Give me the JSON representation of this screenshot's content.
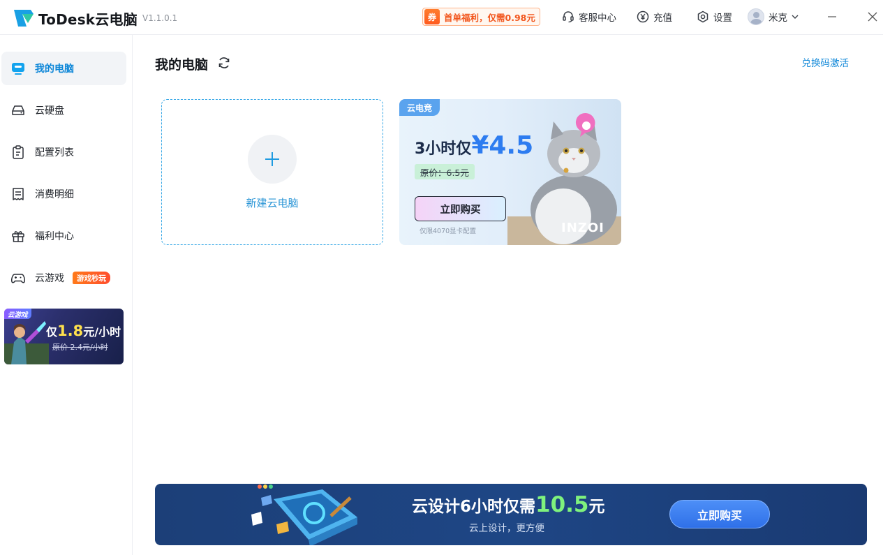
{
  "app": {
    "name": "ToDesk云电脑",
    "version": "V1.1.0.1"
  },
  "titlebar": {
    "promo_tag": "券",
    "promo_text": "首单福利，仅需0.98元",
    "service_label": "客服中心",
    "recharge_label": "充值",
    "settings_label": "设置",
    "user_name": "米克"
  },
  "sidebar": {
    "items": [
      {
        "label": "我的电脑",
        "icon": "monitor-icon",
        "active": true
      },
      {
        "label": "云硬盘",
        "icon": "hard-drive-icon"
      },
      {
        "label": "配置列表",
        "icon": "clipboard-icon"
      },
      {
        "label": "消费明细",
        "icon": "receipt-icon"
      },
      {
        "label": "福利中心",
        "icon": "gift-icon"
      },
      {
        "label": "云游戏",
        "icon": "gamepad-icon",
        "badge": "游戏秒玩"
      }
    ],
    "banner": {
      "tag": "云游戏",
      "prefix": "仅",
      "price": "1.8",
      "unit": "元/小时",
      "original": "原价 2.4元/小时"
    }
  },
  "main": {
    "title": "我的电脑",
    "redeem_link": "兑换码激活",
    "new_computer_label": "新建云电脑",
    "promo_card": {
      "tag": "云电竞",
      "headline_prefix": "3小时仅",
      "currency": "¥",
      "price": "4.5",
      "original_price": "原价：6.5元",
      "button": "立即购买",
      "note": "仅限4070显卡配置",
      "brand": "INZOI"
    }
  },
  "bottom_banner": {
    "headline": "云设计6小时仅需",
    "price": "10.5",
    "unit": "元",
    "subline": "云上设计，更方便",
    "button": "立即购买"
  },
  "colors": {
    "accent": "#0c86d8",
    "promo_orange": "#f2561d",
    "banner_bg": "#1e4685",
    "price_green": "#7ff27d"
  }
}
